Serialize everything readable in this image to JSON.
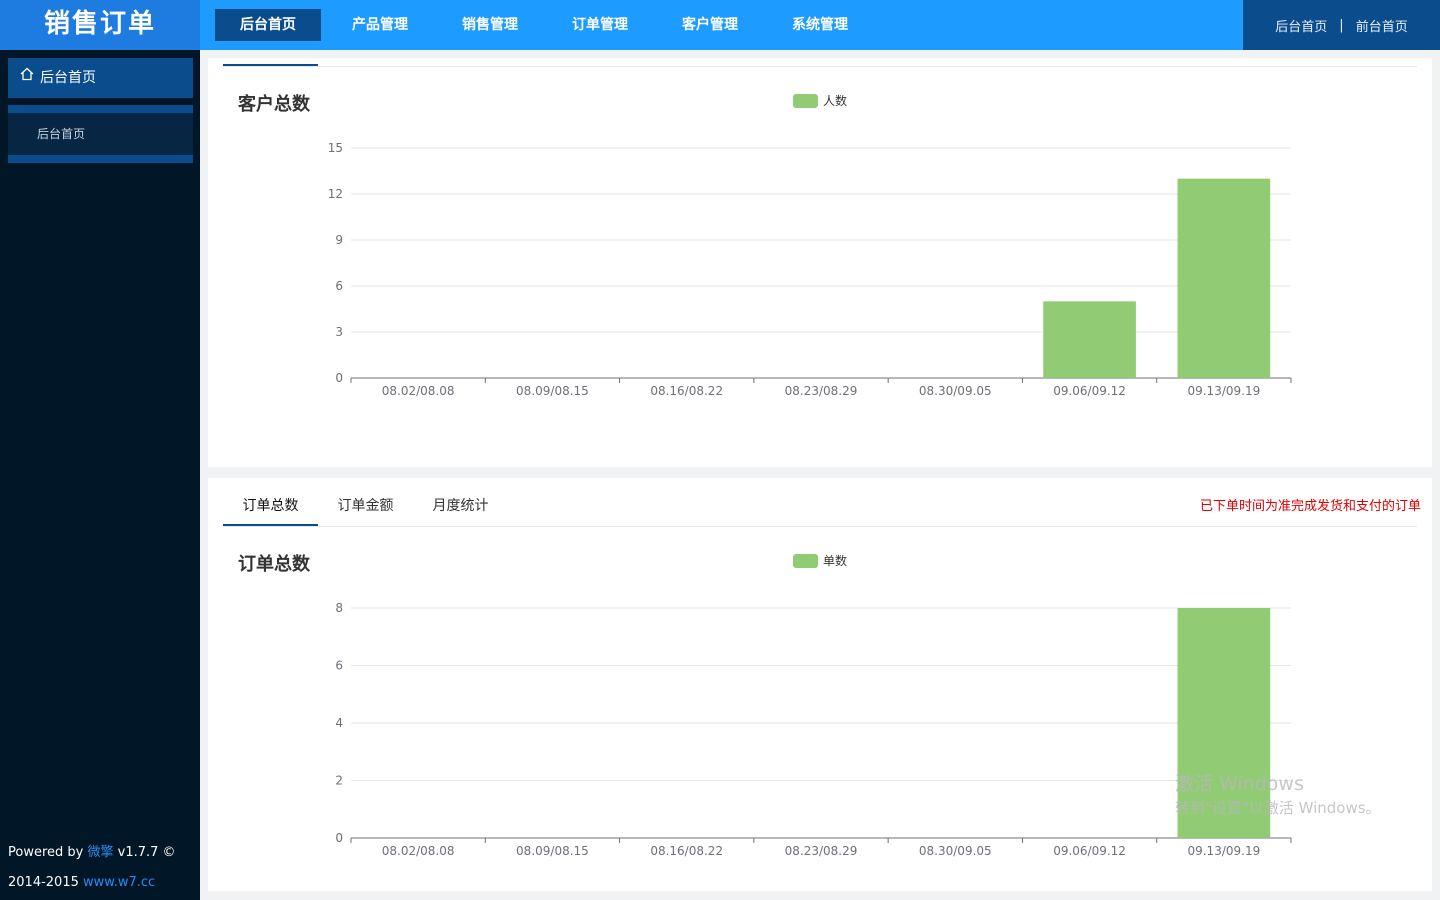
{
  "header": {
    "logo": "销售订单",
    "nav": [
      {
        "label": "后台首页",
        "active": true
      },
      {
        "label": "产品管理"
      },
      {
        "label": "销售管理"
      },
      {
        "label": "订单管理"
      },
      {
        "label": "客户管理"
      },
      {
        "label": "系统管理"
      }
    ],
    "right_links": {
      "back": "后台首页",
      "sep": "|",
      "front": "前台首页"
    }
  },
  "sidebar": {
    "head": "后台首页",
    "items": [
      {
        "label": "后台首页"
      }
    ],
    "footer": {
      "powered_prefix": "Powered by ",
      "brand": "微擎",
      "version": " v1.7.7 ©",
      "years": "2014-2015 ",
      "site": "www.w7.cc"
    }
  },
  "panel_customers": {
    "title": "客户总数"
  },
  "panel_orders": {
    "tabs": [
      {
        "label": "订单总数",
        "active": true
      },
      {
        "label": "订单金额"
      },
      {
        "label": "月度统计"
      }
    ],
    "notice": "已下单时间为准完成发货和支付的订单",
    "title": "订单总数"
  },
  "watermark": {
    "line1": "激活 Windows",
    "line2": "转到\"设置\"以激活 Windows。"
  },
  "colors": {
    "bar": "#91cc75",
    "accent": "#0b4c8c",
    "topbar": "#1e9bff",
    "notice": "#e00000"
  },
  "chart_data": [
    {
      "type": "bar",
      "title": "客户总数",
      "categories": [
        "08.02/08.08",
        "08.09/08.15",
        "08.16/08.22",
        "08.23/08.29",
        "08.30/09.05",
        "09.06/09.12",
        "09.13/09.19"
      ],
      "series": [
        {
          "name": "人数",
          "values": [
            0,
            0,
            0,
            0,
            0,
            5,
            13
          ]
        }
      ],
      "yticks": [
        0,
        3,
        6,
        9,
        12,
        15
      ],
      "ylim": [
        0,
        15
      ],
      "grid": true,
      "legend": "top-center"
    },
    {
      "type": "bar",
      "title": "订单总数",
      "categories": [
        "08.02/08.08",
        "08.09/08.15",
        "08.16/08.22",
        "08.23/08.29",
        "08.30/09.05",
        "09.06/09.12",
        "09.13/09.19"
      ],
      "series": [
        {
          "name": "单数",
          "values": [
            0,
            0,
            0,
            0,
            0,
            0,
            8
          ]
        }
      ],
      "yticks": [
        0,
        2,
        4,
        6,
        8
      ],
      "ylim": [
        0,
        8
      ],
      "grid": true,
      "legend": "top-center"
    }
  ]
}
